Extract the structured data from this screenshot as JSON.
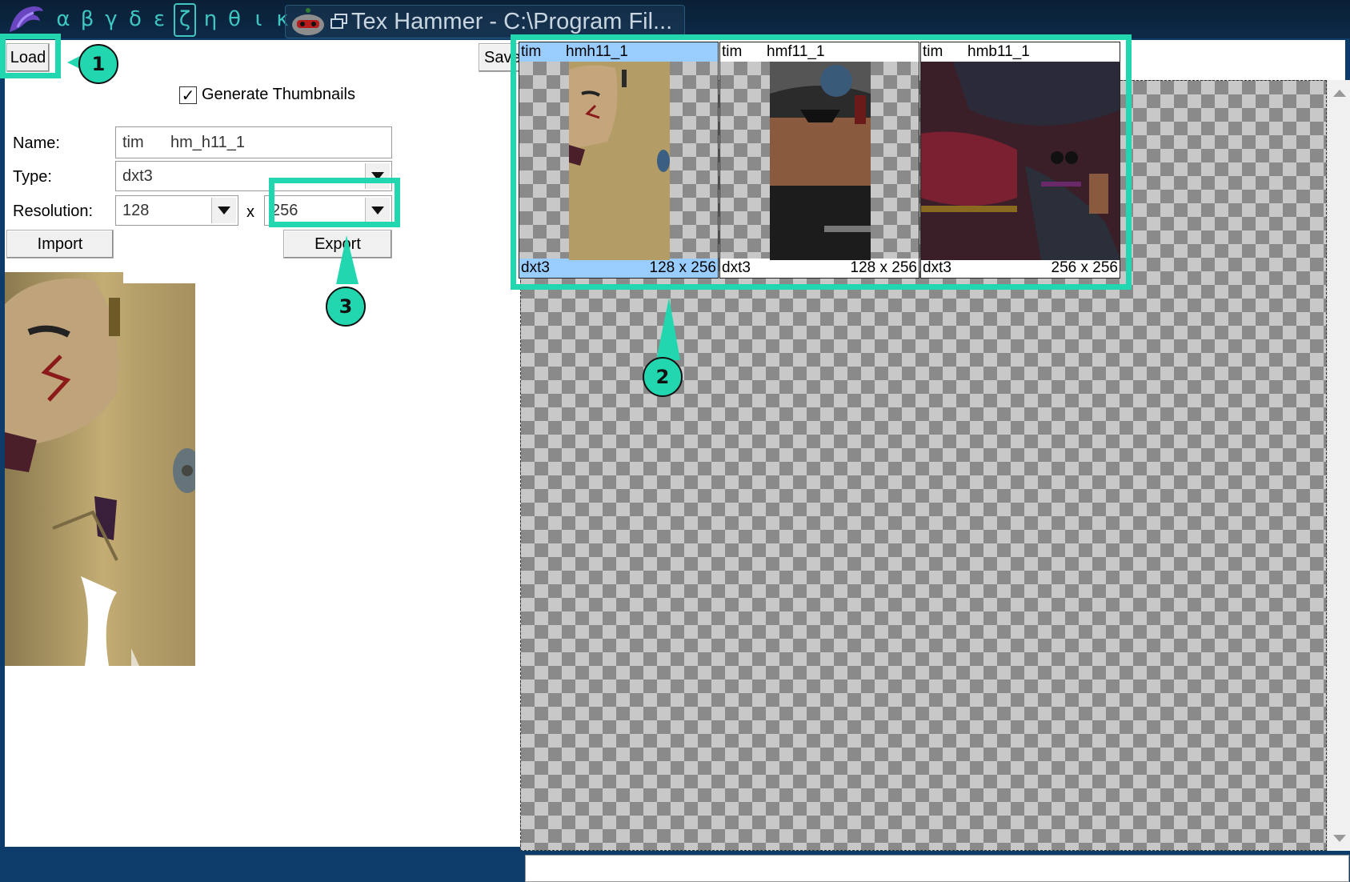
{
  "taskbar": {
    "greek_letters": [
      "α",
      "β",
      "γ",
      "δ",
      "ε",
      "ζ",
      "η",
      "θ",
      "ι",
      "κ"
    ],
    "active_letter_index": 5,
    "task_title": "Tex Hammer - C:\\Program Fil..."
  },
  "toolbar": {
    "load_label": "Load",
    "generate_thumbnails_label": "Generate Thumbnails",
    "generate_thumbnails_checked": true,
    "save_label": "Save"
  },
  "form": {
    "name_label": "Name:",
    "name_value": "tim      hm_h11_1",
    "type_label": "Type:",
    "type_value": "dxt3",
    "resolution_label": "Resolution:",
    "res_width": "128",
    "res_x": "x",
    "res_height": "256",
    "import_label": "Import",
    "export_label": "Export"
  },
  "thumbnails": [
    {
      "head1": "tim",
      "head2": "hmh11_1",
      "foot1": "dxt3",
      "foot2": "128 x 256",
      "selected": true
    },
    {
      "head1": "tim",
      "head2": "hmf11_1",
      "foot1": "dxt3",
      "foot2": "128 x 256",
      "selected": false
    },
    {
      "head1": "tim",
      "head2": "hmb11_1",
      "foot1": "dxt3",
      "foot2": "256 x 256",
      "selected": false
    }
  ],
  "callouts": {
    "one": "1",
    "two": "2",
    "three": "3"
  },
  "colors": {
    "highlight": "#22d6b0",
    "selection": "#99ccff",
    "taskbar_text": "#3fc6c0"
  }
}
